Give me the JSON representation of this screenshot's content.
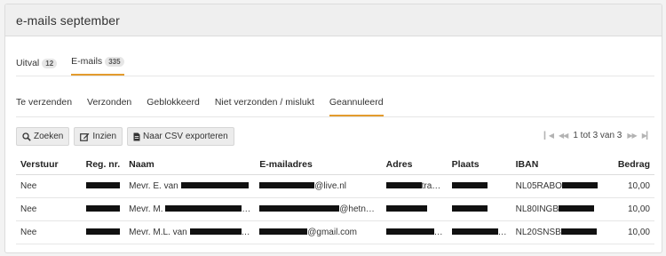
{
  "panel": {
    "title": "e-mails september"
  },
  "tabs_top": [
    {
      "label": "Uitval",
      "count": "12",
      "active": false
    },
    {
      "label": "E-mails",
      "count": "335",
      "active": true
    }
  ],
  "tabs_status": [
    {
      "label": "Te verzenden",
      "active": false
    },
    {
      "label": "Verzonden",
      "active": false
    },
    {
      "label": "Geblokkeerd",
      "active": false
    },
    {
      "label": "Niet verzonden / mislukt",
      "active": false
    },
    {
      "label": "Geannuleerd",
      "active": true
    }
  ],
  "toolbar": {
    "search_label": "Zoeken",
    "view_label": "Inzien",
    "export_label": "Naar CSV exporteren"
  },
  "pager": {
    "range": "1 tot 3 van 3"
  },
  "table": {
    "headers": [
      "Verstuur",
      "Reg. nr.",
      "Naam",
      "E-mailadres",
      "Adres",
      "Plaats",
      "IBAN",
      "Bedrag"
    ],
    "rows": [
      {
        "verstuur": "Nee",
        "naam": "Mevr. E. van",
        "email": "@live.nl",
        "adres": "tra…",
        "iban": "NL05RABO",
        "bedrag": "10,00"
      },
      {
        "verstuur": "Nee",
        "naam": "Mevr. M.",
        "email": "@hetn…",
        "adres": "",
        "iban": "NL80INGB",
        "bedrag": "10,00"
      },
      {
        "verstuur": "Nee",
        "naam": "Mevr. M.L. van",
        "email": "@gmail.com",
        "adres": "…",
        "iban": "NL20SNSB",
        "bedrag": "10,00"
      }
    ]
  },
  "colors": {
    "accent": "#e39b2d",
    "header_bg": "#efefef",
    "button_bg": "#ececec"
  }
}
